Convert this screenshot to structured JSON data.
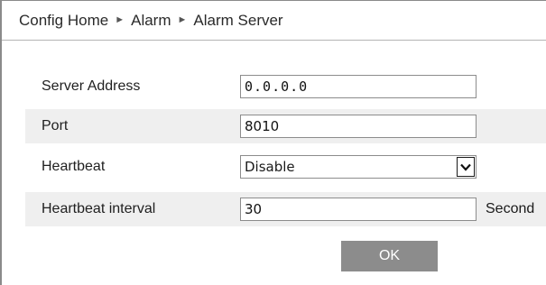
{
  "breadcrumb": {
    "items": [
      "Config Home",
      "Alarm",
      "Alarm Server"
    ],
    "separator": "►"
  },
  "form": {
    "server_address": {
      "label": "Server Address",
      "value": "0.0.0.0"
    },
    "port": {
      "label": "Port",
      "value": "8010"
    },
    "heartbeat": {
      "label": "Heartbeat",
      "value": "Disable"
    },
    "heartbeat_interval": {
      "label": "Heartbeat interval",
      "value": "30",
      "unit": "Second"
    }
  },
  "actions": {
    "ok_label": "OK"
  },
  "colors": {
    "row_shade": "#efefef",
    "button_bg": "#8c8c8c",
    "button_text": "#ffffff"
  }
}
